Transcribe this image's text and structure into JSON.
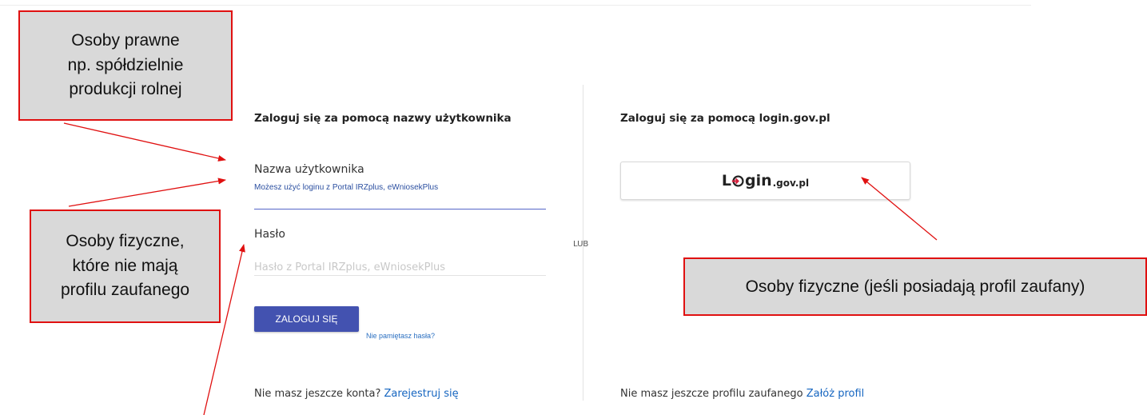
{
  "username_login": {
    "heading": "Zaloguj się za pomocą nazwy użytkownika",
    "username_label": "Nazwa użytkownika",
    "username_hint": "Możesz użyć loginu z Portal IRZplus, eWniosekPlus",
    "username_value": "",
    "password_label": "Hasło",
    "password_placeholder": "Hasło z Portal IRZplus, eWniosekPlus",
    "login_button": "ZALOGUJ SIĘ",
    "forgot_password": "Nie pamiętasz hasła?",
    "no_account_text": "Nie masz jeszcze konta?",
    "register_link": "Zarejestruj się"
  },
  "or_label": "LUB",
  "gov_login": {
    "heading": "Zaloguj się za pomocą login.gov.pl",
    "logo_text_part1": "L",
    "logo_text_part2": "gin",
    "logo_text_part3": ".gov.pl",
    "no_profile_text": "Nie masz jeszcze profilu zaufanego",
    "create_profile_link": "Załóż profil"
  },
  "annotations": {
    "legal_entities": {
      "line1": "Osoby prawne",
      "line2": "np. spółdzielnie",
      "line3": "produkcji rolnej"
    },
    "no_trusted_profile": {
      "line1": "Osoby fizyczne,",
      "line2": "które nie mają",
      "line3": "profilu zaufanego"
    },
    "trusted_profile": "Osoby fizyczne (jeśli posiadają profil zaufany)"
  },
  "colors": {
    "primary_button": "#4352b0",
    "link": "#1565c0",
    "input_focus_underline": "#5566c8",
    "callout_border": "#e01010",
    "callout_fill": "#d9d9d9",
    "logo_accent": "#d4213d"
  },
  "icons": {
    "logo_mark": "login-gov-circle-arrow-icon"
  }
}
